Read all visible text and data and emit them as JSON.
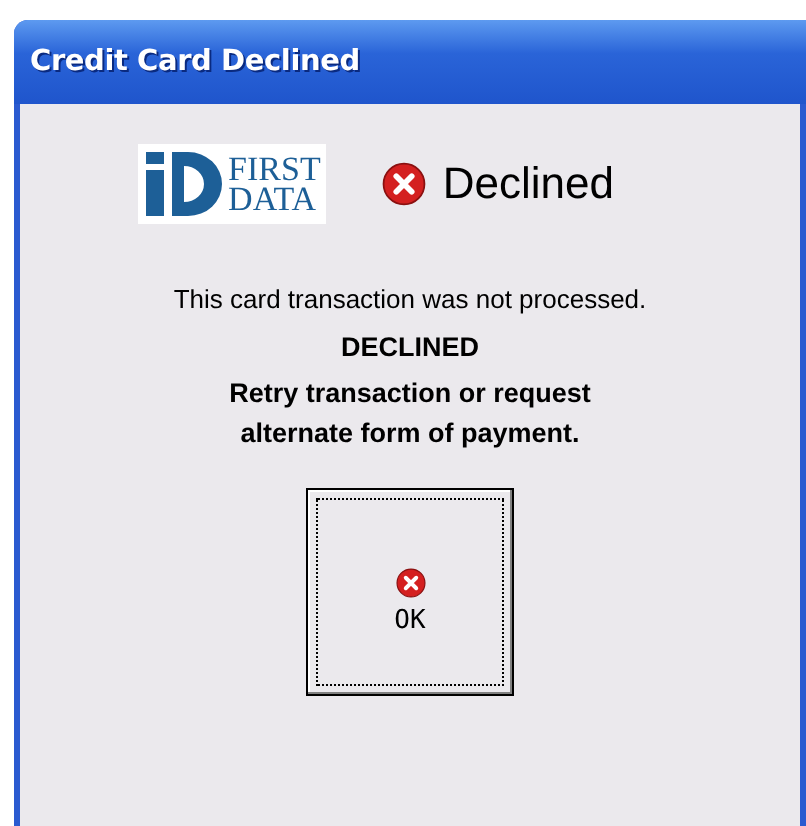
{
  "window": {
    "title": "Credit Card Declined"
  },
  "logo": {
    "lines": [
      "FIRST",
      "DATA"
    ]
  },
  "status": {
    "label": "Declined"
  },
  "message": "This card transaction was not processed.",
  "result": "DECLINED",
  "instruction": "Retry transaction or request alternate form of payment.",
  "buttons": [
    {
      "label": "OK",
      "focused": true
    }
  ]
}
